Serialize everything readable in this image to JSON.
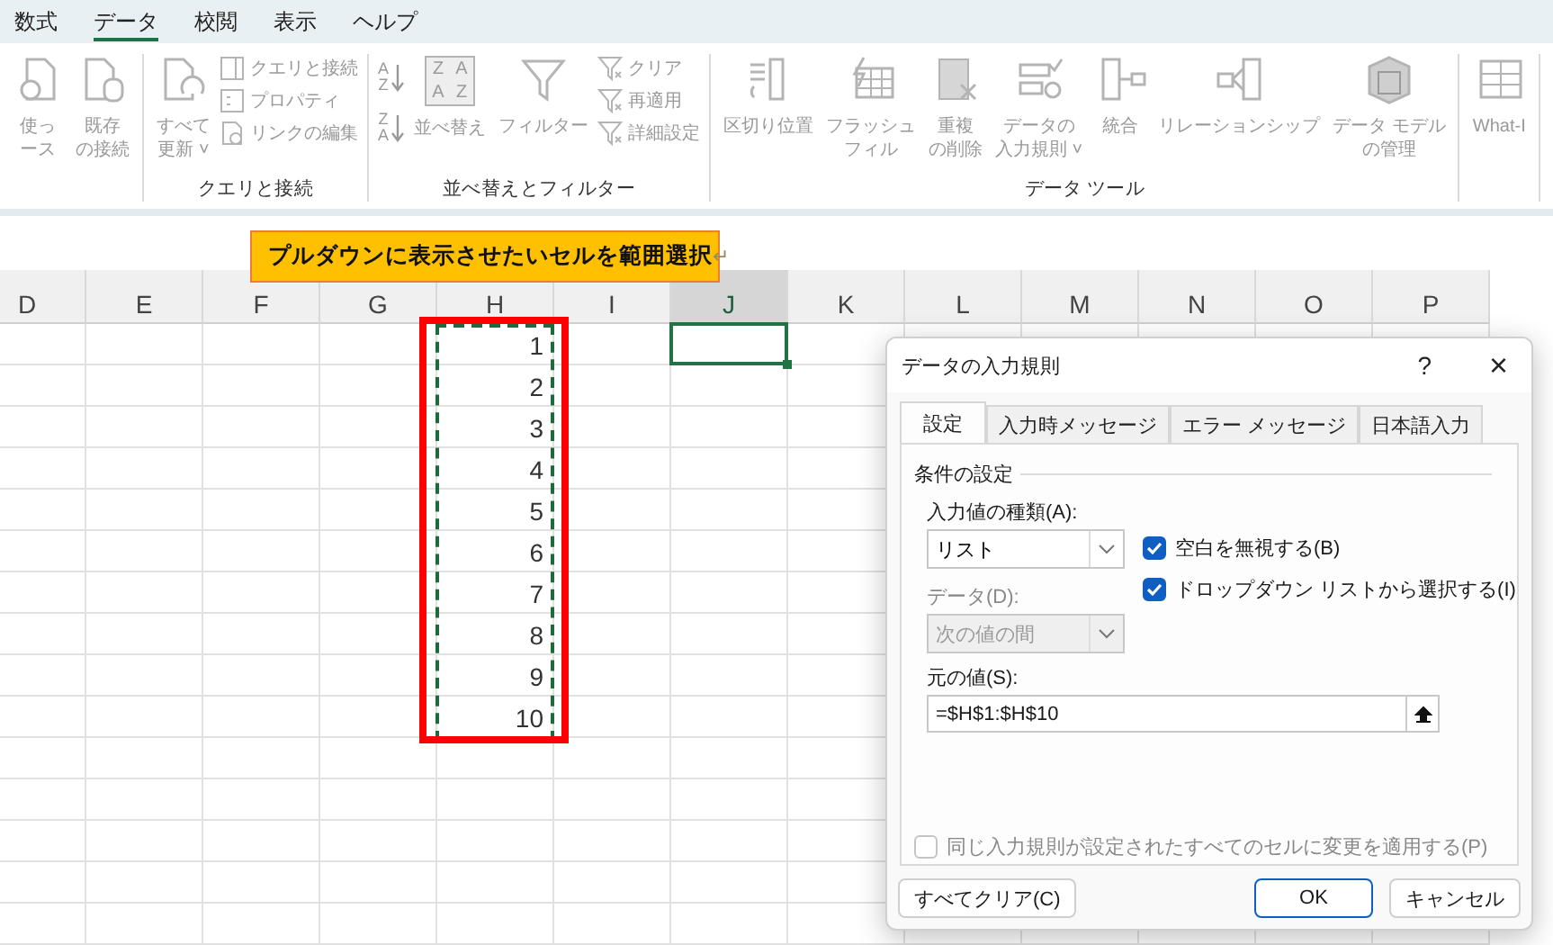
{
  "menu_tabs": [
    {
      "label": "数式",
      "selected": false
    },
    {
      "label": "データ",
      "selected": true
    },
    {
      "label": "校閲",
      "selected": false
    },
    {
      "label": "表示",
      "selected": false
    },
    {
      "label": "ヘルプ",
      "selected": false
    }
  ],
  "ribbon": {
    "groups": [
      {
        "items": [
          {
            "kind": "large",
            "lines": [
              "使っ",
              "ース"
            ]
          },
          {
            "kind": "large",
            "lines": [
              "既存",
              "の接続"
            ]
          }
        ]
      },
      {
        "label": "クエリと接続",
        "items": [
          {
            "kind": "large",
            "lines": [
              "すべて",
              "更新 ˅"
            ]
          },
          {
            "kind": "stack",
            "entries": [
              "クエリと接続",
              "プロパティ",
              "リンクの編集"
            ]
          }
        ]
      },
      {
        "label": "並べ替えとフィルター",
        "items": [
          {
            "kind": "sort",
            "keys": [
              [
                "A",
                "Z"
              ],
              [
                "Z",
                "A"
              ]
            ]
          },
          {
            "kind": "grid",
            "letters": [
              "Z",
              "A",
              "A",
              "Z"
            ],
            "lines": [
              "並べ替え"
            ]
          },
          {
            "kind": "large",
            "lines": [
              "フィルター"
            ]
          },
          {
            "kind": "stack",
            "entries": [
              "クリア",
              "再適用",
              "詳細設定"
            ]
          }
        ]
      },
      {
        "label": "データ ツール",
        "items": [
          {
            "kind": "large",
            "lines": [
              "区切り位置"
            ]
          },
          {
            "kind": "large",
            "lines": [
              "フラッシュ",
              "フィル"
            ]
          },
          {
            "kind": "large",
            "lines": [
              "重複",
              "の削除"
            ]
          },
          {
            "kind": "large",
            "lines": [
              "データの",
              "入力規則 ˅"
            ]
          },
          {
            "kind": "large",
            "lines": [
              "統合"
            ]
          },
          {
            "kind": "large",
            "lines": [
              "リレーションシップ"
            ]
          },
          {
            "kind": "large",
            "lines": [
              "データ モデル",
              "の管理"
            ]
          }
        ]
      },
      {
        "items": [
          {
            "kind": "large",
            "lines": [
              "What-I"
            ]
          }
        ]
      }
    ]
  },
  "sheet": {
    "columns": [
      {
        "label": "D",
        "selected": false,
        "marquee": false
      },
      {
        "label": "E",
        "selected": false,
        "marquee": false
      },
      {
        "label": "F",
        "selected": false,
        "marquee": false
      },
      {
        "label": "G",
        "selected": false,
        "marquee": false
      },
      {
        "label": "H",
        "selected": false,
        "marquee": true,
        "values": [
          "1",
          "2",
          "3",
          "4",
          "5",
          "6",
          "7",
          "8",
          "9",
          "10"
        ]
      },
      {
        "label": "I",
        "selected": false,
        "marquee": false
      },
      {
        "label": "J",
        "selected": true,
        "marquee": false
      },
      {
        "label": "K",
        "selected": false,
        "marquee": false
      },
      {
        "label": "L",
        "selected": false,
        "marquee": false
      },
      {
        "label": "M",
        "selected": false,
        "marquee": false
      },
      {
        "label": "N",
        "selected": false,
        "marquee": false
      },
      {
        "label": "O",
        "selected": false,
        "marquee": false
      },
      {
        "label": "P",
        "selected": false,
        "marquee": false
      }
    ]
  },
  "callout": {
    "text": "プルダウンに表示させたいセルを範囲選択",
    "mark": "↵"
  },
  "dialog": {
    "title": "データの入力規則",
    "help": "?",
    "close": "×",
    "tabs": [
      {
        "label": "設定",
        "selected": true
      },
      {
        "label": "入力時メッセージ",
        "selected": false
      },
      {
        "label": "エラー メッセージ",
        "selected": false
      },
      {
        "label": "日本語入力",
        "selected": false
      }
    ],
    "section": "条件の設定",
    "type_label": "入力値の種類(A):",
    "type_value": "リスト",
    "checkboxes": [
      {
        "label": "空白を無視する(B)",
        "checked": true
      },
      {
        "label": "ドロップダウン リストから選択する(I)",
        "checked": true
      }
    ],
    "data_label": "データ(D):",
    "data_value": "次の値の間",
    "data_disabled": true,
    "source_label": "元の値(S):",
    "source_value": "=$H$1:$H$10",
    "apply_all": {
      "label": "同じ入力規則が設定されたすべてのセルに変更を適用する(P)",
      "checked": false,
      "disabled": true
    },
    "clear_button": "すべてクリア(C)",
    "buttons": [
      {
        "label": "OK",
        "default": true
      },
      {
        "label": "キャンセル",
        "default": false
      }
    ]
  }
}
